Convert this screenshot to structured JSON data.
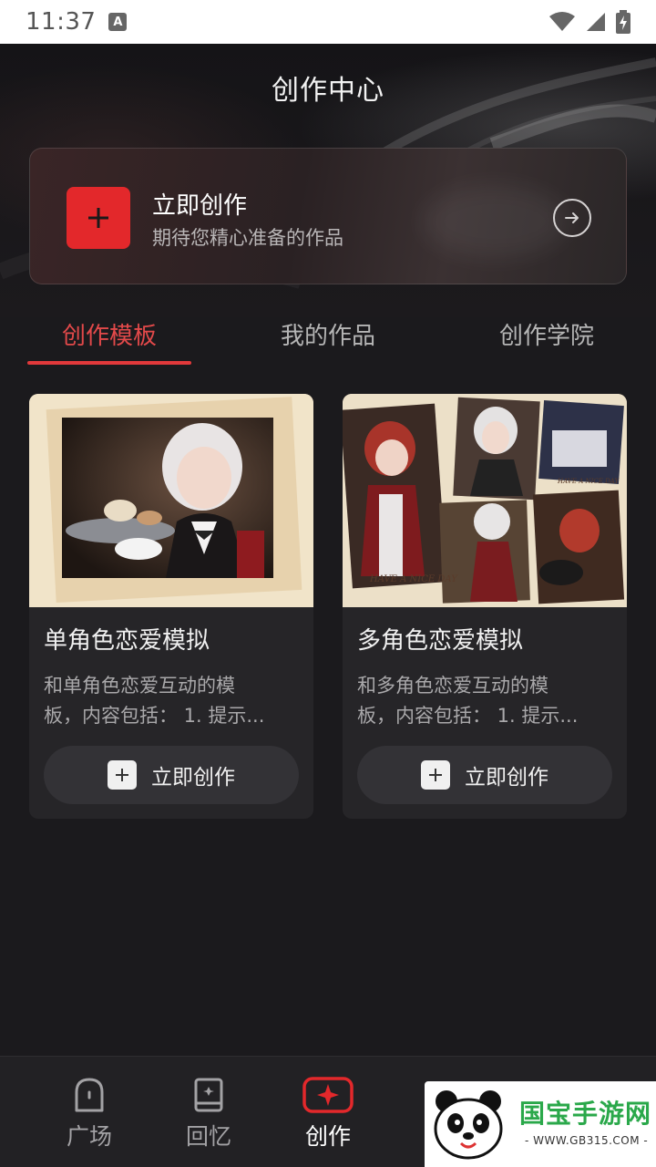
{
  "status_bar": {
    "time": "11:37",
    "notification_letter": "A"
  },
  "header": {
    "title": "创作中心"
  },
  "create_banner": {
    "title": "立即创作",
    "subtitle": "期待您精心准备的作品"
  },
  "tabs": [
    {
      "label": "创作模板",
      "active": true
    },
    {
      "label": "我的作品",
      "active": false
    },
    {
      "label": "创作学院",
      "active": false
    }
  ],
  "cards": [
    {
      "title": "单角色恋爱模拟",
      "desc_line1": "和单角色恋爱互动的模",
      "desc_line2": "板，内容包括：  1. 提示...",
      "button_label": "立即创作"
    },
    {
      "title": "多角色恋爱模拟",
      "desc_line1": "和多角色恋爱互动的模",
      "desc_line2": "板，内容包括：  1. 提示...",
      "button_label": "立即创作"
    }
  ],
  "bottom_nav": [
    {
      "label": "广场",
      "icon": "plaza-icon",
      "active": false
    },
    {
      "label": "回忆",
      "icon": "memory-book-icon",
      "active": false
    },
    {
      "label": "创作",
      "icon": "create-sparkle-icon",
      "active": true
    }
  ],
  "watermark": {
    "brand": "国宝手游网",
    "url": "- WWW.GB315.COM -"
  },
  "colors": {
    "accent": "#e3282b",
    "background": "#1b1a1d",
    "card": "#262528"
  }
}
